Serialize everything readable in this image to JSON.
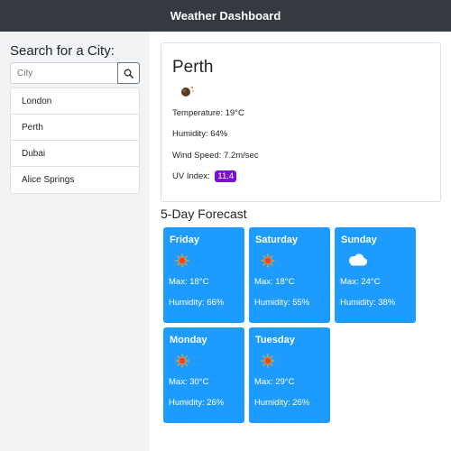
{
  "header": {
    "title": "Weather Dashboard"
  },
  "sidebar": {
    "heading": "Search for a City:",
    "search_placeholder": "City",
    "search_icon": "search-icon",
    "cities": [
      "London",
      "Perth",
      "Dubai",
      "Alice Springs"
    ]
  },
  "current": {
    "city": "Perth",
    "icon": "moon-icon",
    "temperature": "Temperature:  19°C",
    "humidity": "Humidity:  64%",
    "wind": "Wind Speed:  7.2m/sec",
    "uv_label": "UV Index:",
    "uv_value": "11.4",
    "uv_color": "#7c0fd2"
  },
  "forecast": {
    "title": "5-Day Forecast",
    "card_color": "#1e9bff",
    "days": [
      {
        "day": "Friday",
        "icon": "sun-icon",
        "max": "Max: 18°C",
        "humidity": "Humidity: 66%"
      },
      {
        "day": "Saturday",
        "icon": "sun-icon",
        "max": "Max: 18°C",
        "humidity": "Humidity: 55%"
      },
      {
        "day": "Sunday",
        "icon": "cloud-icon",
        "max": "Max: 24°C",
        "humidity": "Humidity: 38%"
      },
      {
        "day": "Monday",
        "icon": "sun-icon",
        "max": "Max: 30°C",
        "humidity": "Humidity: 26%"
      },
      {
        "day": "Tuesday",
        "icon": "sun-icon",
        "max": "Max: 29°C",
        "humidity": "Humidity: 26%"
      }
    ]
  }
}
